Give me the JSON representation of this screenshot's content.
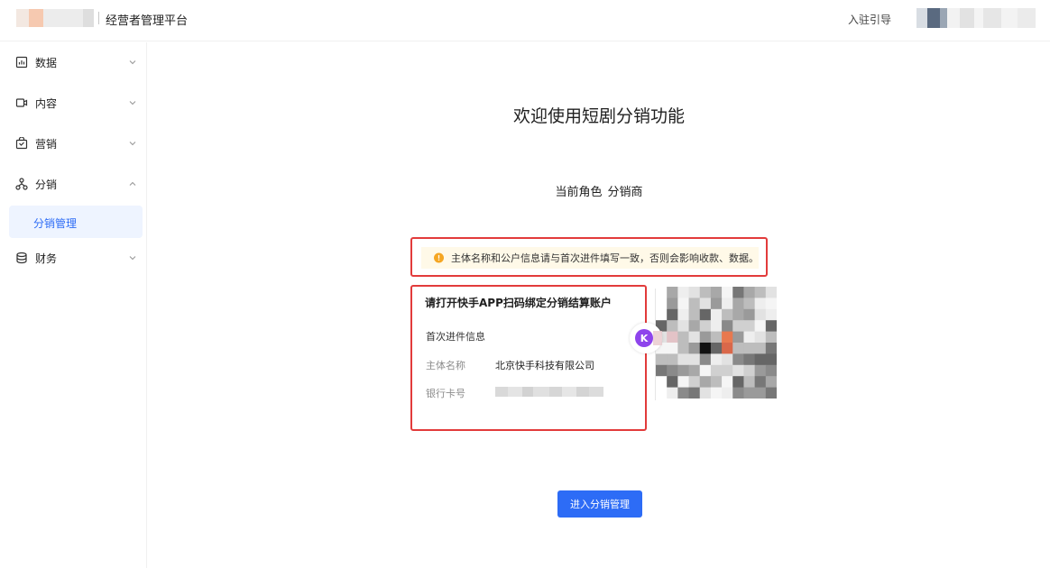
{
  "header": {
    "platform_title": "经营者管理平台",
    "guide_link": "入驻引导"
  },
  "sidebar": {
    "items": [
      {
        "label": "数据",
        "icon": "chart-icon"
      },
      {
        "label": "内容",
        "icon": "video-icon"
      },
      {
        "label": "营销",
        "icon": "bag-icon"
      },
      {
        "label": "分销",
        "icon": "network-icon",
        "expanded": true
      },
      {
        "label": "财务",
        "icon": "coins-icon"
      }
    ],
    "submenu_active": "分销管理"
  },
  "main": {
    "welcome_title": "欢迎使用短剧分销功能",
    "role_label": "当前角色",
    "role_value": "分销商",
    "warning_text": "主体名称和公户信息请与首次进件填写一致，否则会影响收款、数据。",
    "bind": {
      "title": "请打开快手APP扫码绑定分销结算账户",
      "section_title": "首次进件信息",
      "entity_label": "主体名称",
      "entity_value": "北京快手科技有限公司",
      "bank_label": "银行卡号"
    },
    "enter_button": "进入分销管理"
  },
  "colors": {
    "primary": "#2d6cf6",
    "highlight_border": "#e23b3b",
    "warning_bg": "#fff9e8",
    "warning_icon": "#f5a623"
  }
}
